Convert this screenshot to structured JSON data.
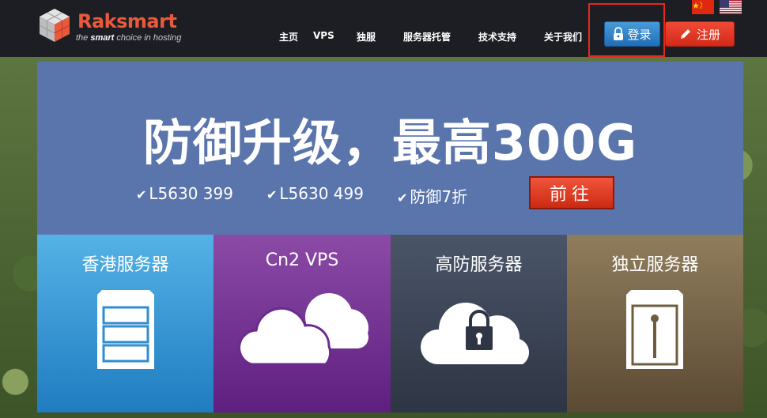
{
  "brand": {
    "name": "Raksmart",
    "tagline_pre": "the ",
    "tagline_bold": "smart",
    "tagline_post": " choice in hosting"
  },
  "nav": {
    "items": [
      "主页",
      "VPS",
      "独服",
      "服务器托管",
      "技术支持",
      "关于我们"
    ]
  },
  "auth": {
    "login_label": "登录",
    "register_label": "注册"
  },
  "banner": {
    "title": "防御升级，最高300G",
    "promos": [
      "L5630 399",
      "L5630 499",
      "防御7折"
    ],
    "cta_label": "前往"
  },
  "tiles": [
    {
      "title": "香港服务器"
    },
    {
      "title": "Cn2 VPS"
    },
    {
      "title": "高防服务器"
    },
    {
      "title": "独立服务器"
    }
  ],
  "colors": {
    "header_bg": "#1d1e24",
    "brand_orange": "#e85a3b",
    "banner_bg": "#5a75ac",
    "login_blue": "#1f6eb8",
    "register_red": "#d32a18",
    "highlight_red": "#e5271c"
  },
  "icons": {
    "logo": "cube-logo-icon",
    "flag_cn": "china-flag-icon",
    "flag_us": "us-flag-icon",
    "login": "lock-icon",
    "register": "pencil-icon",
    "check": "check-icon",
    "tile_hk": "server-rack-icon",
    "tile_cn2": "cloud-icon",
    "tile_ddos": "cloud-lock-icon",
    "tile_dedi": "server-tower-icon"
  }
}
